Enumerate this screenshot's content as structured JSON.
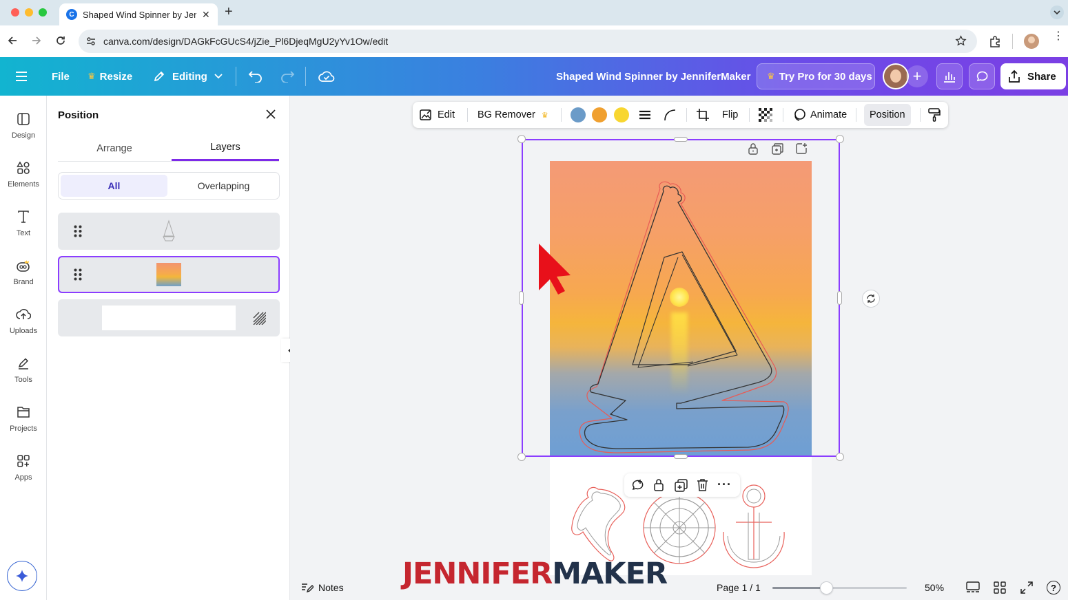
{
  "browser": {
    "tab_title": "Shaped Wind Spinner by JenniferMaker",
    "url": "canva.com/design/DAGkFcGUcS4/jZie_Pl6DjeqMgU2yYv1Ow/edit",
    "favicon_letter": "C"
  },
  "header": {
    "file_label": "File",
    "resize_label": "Resize",
    "editing_label": "Editing",
    "doc_title": "Shaped Wind Spinner by JenniferMaker",
    "try_pro_label": "Try Pro for 30 days",
    "share_label": "Share"
  },
  "rail": {
    "items": [
      {
        "label": "Design",
        "icon": "design-icon"
      },
      {
        "label": "Elements",
        "icon": "elements-icon"
      },
      {
        "label": "Text",
        "icon": "text-icon"
      },
      {
        "label": "Brand",
        "icon": "brand-icon"
      },
      {
        "label": "Uploads",
        "icon": "uploads-icon"
      },
      {
        "label": "Tools",
        "icon": "tools-icon"
      },
      {
        "label": "Projects",
        "icon": "projects-icon"
      },
      {
        "label": "Apps",
        "icon": "apps-icon"
      }
    ]
  },
  "panel": {
    "title": "Position",
    "tabs": [
      "Arrange",
      "Layers"
    ],
    "active_tab": "Layers",
    "filters": [
      "All",
      "Overlapping"
    ],
    "active_filter": "All"
  },
  "toolbar": {
    "edit_label": "Edit",
    "bg_remover_label": "BG Remover",
    "flip_label": "Flip",
    "animate_label": "Animate",
    "position_label": "Position",
    "swatches": [
      "#6b9bc8",
      "#f0a030",
      "#f8d630"
    ]
  },
  "footer": {
    "notes_label": "Notes",
    "page_label": "Page 1 / 1",
    "zoom_label": "50%",
    "zoom_level": 0.4
  },
  "watermark": {
    "part1": "JENNIFER",
    "part2": "MAKER"
  },
  "colors": {
    "selection": "#8b3dff",
    "cut_line": "#e8605a",
    "accent": "#8b3dff"
  }
}
